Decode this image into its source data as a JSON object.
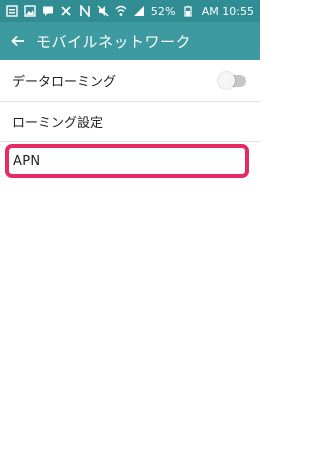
{
  "status_bar": {
    "battery": "52%",
    "time": "AM 10:55",
    "left_icons": [
      "notification-box-icon",
      "image-icon",
      "message-icon",
      "tools-icon"
    ],
    "right_icons": [
      "nfc-icon",
      "mute-icon",
      "wifi-icon",
      "signal-icon",
      "battery-icon"
    ]
  },
  "app_bar": {
    "title": "モバイルネットワーク",
    "back_icon": "back-arrow-icon"
  },
  "settings": {
    "items": [
      {
        "label": "データローミング",
        "toggle_on": false
      },
      {
        "label": "ローミング設定"
      },
      {
        "label": "APN",
        "highlighted": true
      }
    ]
  },
  "colors": {
    "status_bar": "#2f8d93",
    "app_bar": "#3c9aa0",
    "highlight_border": "#e52a64"
  }
}
